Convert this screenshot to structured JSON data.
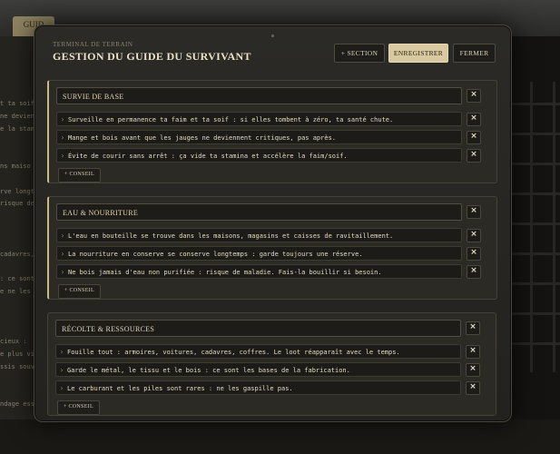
{
  "background": {
    "tab_label": "GUID",
    "left_lines": [
      "t ta soif :",
      "ne devien",
      "e la stam",
      "",
      "",
      "ns maiso",
      "",
      "rve longt",
      "risque de",
      "",
      "",
      "",
      "cadavres,",
      "",
      ": ce sont l",
      "e ne les",
      "",
      "",
      "",
      "cieux :",
      "e plus vite",
      "ssis souvr",
      "",
      "",
      "ndage ess"
    ]
  },
  "modal": {
    "kicker": "TERMINAL DE TERRAIN",
    "title": "GESTION DU GUIDE DU SURVIVANT",
    "buttons": {
      "add_section": "+ SECTION",
      "save": "ENREGISTRER",
      "close": "FERMER"
    },
    "sections": [
      {
        "title": "SURVIE DE BASE",
        "tips": [
          "Surveille en permanence ta faim et ta soif : si elles tombent à zéro, ta santé chute.",
          "Mange et bois avant que les jauges ne deviennent critiques, pas après.",
          "Évite de courir sans arrêt : ça vide ta stamina et accélère la faim/soif."
        ],
        "add_label": "+ CONSEIL"
      },
      {
        "title": "EAU & NOURRITURE",
        "tips": [
          "L'eau en bouteille se trouve dans les maisons, magasins et caisses de ravitaillement.",
          "La nourriture en conserve se conserve longtemps : garde toujours une réserve.",
          "Ne bois jamais d'eau non purifiée : risque de maladie. Fais-la bouillir si besoin."
        ],
        "add_label": "+ CONSEIL"
      },
      {
        "title": "RÉCOLTE & RESSOURCES",
        "tips": [
          "Fouille tout : armoires, voitures, cadavres, coffres. Le loot réapparaît avec le temps.",
          "Garde le métal, le tissu et le bois : ce sont les bases de la fabrication.",
          "Le carburant et les piles sont rares : ne les gaspille pas."
        ],
        "add_label": "+ CONSEIL"
      }
    ],
    "icons": {
      "remove": "close-icon",
      "expand": "chevron-right-icon"
    },
    "remove_glyph": "×",
    "chevron_glyph": "›"
  }
}
